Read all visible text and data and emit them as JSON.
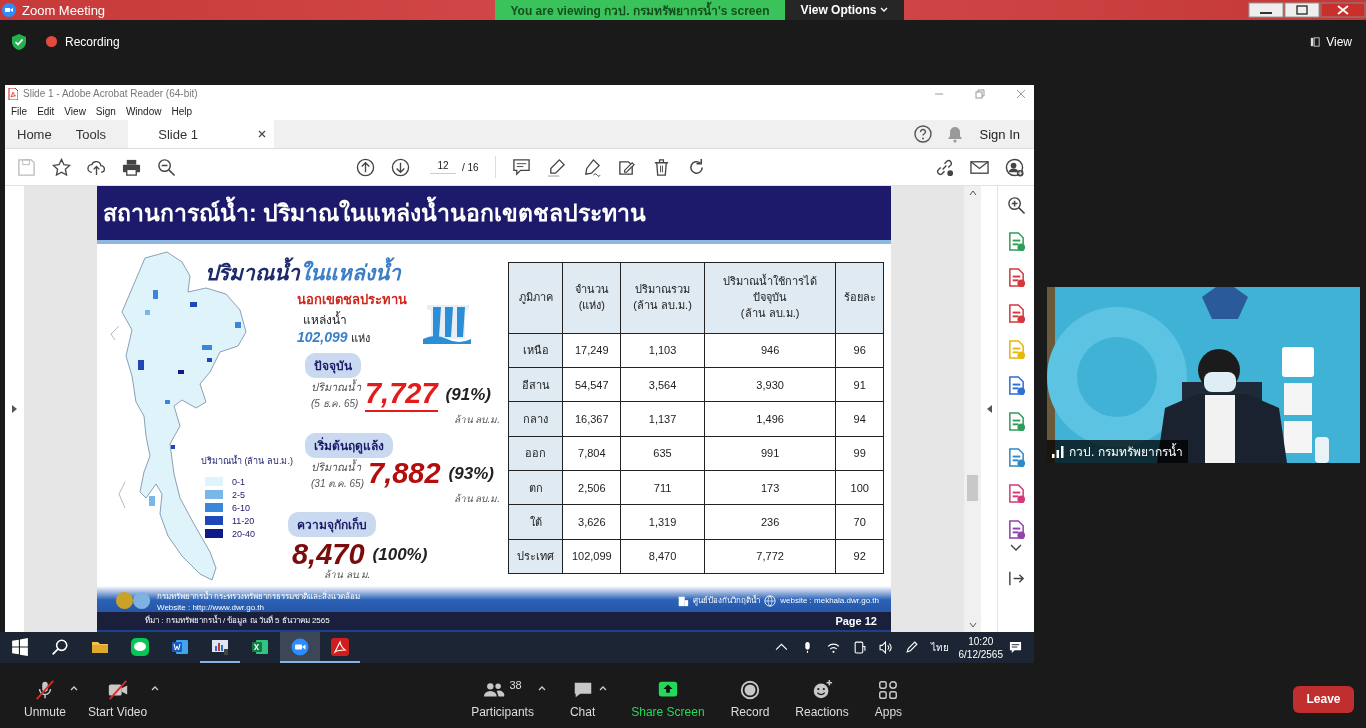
{
  "zoom_title_bar": {
    "title": "Zoom Meeting",
    "viewing_banner": "You are viewing กวป. กรมทรัพยากรน้ำ's screen",
    "view_options": "View Options"
  },
  "meeting_status": {
    "recording": "Recording",
    "view": "View"
  },
  "acrobat": {
    "title": "Slide 1 - Adobe Acrobat Reader (64-bit)",
    "menu": [
      "File",
      "Edit",
      "View",
      "Sign",
      "Window",
      "Help"
    ],
    "tabs": [
      {
        "label": "Home",
        "selected": false
      },
      {
        "label": "Tools",
        "selected": false
      },
      {
        "label": "Slide 1",
        "selected": true
      }
    ],
    "sign_in": "Sign In",
    "page_current": "12",
    "page_total": "/ 16"
  },
  "slide": {
    "title": "สถานการณ์น้ำ: ปริมาณในแหล่งน้ำนอกเขตชลประทาน",
    "heading_main": "ปริมาณน้ำ",
    "heading_accent": "ในแหล่งน้ำ",
    "subtitle": "นอกเขตชลประทาน",
    "sources_label": "แหล่งน้ำ",
    "sources_count": "102,099",
    "sources_unit": "แห่ง",
    "stats": [
      {
        "kind": "current",
        "badge": "ปัจจุบัน",
        "label": "ปริมาณน้ำ",
        "date": "(5 ธ.ค. 65)",
        "value": "7,727",
        "percent": "(91%)",
        "unit": "ล้าน ลบ.ม."
      },
      {
        "kind": "start",
        "badge": "เริ่มต้นฤดูแล้ง",
        "label": "ปริมาณน้ำ",
        "date": "(31 ต.ค. 65)",
        "value": "7,882",
        "percent": "(93%)",
        "unit": "ล้าน ลบ.ม."
      },
      {
        "kind": "capacity",
        "badge": "ความจุกักเก็บ",
        "value": "8,470",
        "percent": "(100%)",
        "unit": "ล้าน ลบ.ม."
      }
    ],
    "legend": {
      "title": "ปริมาณน้ำ (ล้าน ลบ.ม.)",
      "items": [
        {
          "label": "0-1",
          "color": "#dff3fb"
        },
        {
          "label": "2-5",
          "color": "#7ab6e8"
        },
        {
          "label": "6-10",
          "color": "#3a86db"
        },
        {
          "label": "11-20",
          "color": "#1f47b8"
        },
        {
          "label": "20-40",
          "color": "#0d1a8a"
        }
      ]
    },
    "table": {
      "columns": [
        "ภูมิภาค",
        "จำนวน\n(แห่ง)",
        "ปริมาณรวม\n(ล้าน ลบ.ม.)",
        "ปริมาณน้ำใช้การได้\nปัจจุบัน\n(ล้าน ลบ.ม.)",
        "ร้อยละ"
      ],
      "rows": [
        [
          "เหนือ",
          "17,249",
          "1,103",
          "946",
          "96"
        ],
        [
          "อีสาน",
          "54,547",
          "3,564",
          "3,930",
          "91"
        ],
        [
          "กลาง",
          "16,367",
          "1,137",
          "1,496",
          "94"
        ],
        [
          "ออก",
          "7,804",
          "635",
          "991",
          "99"
        ],
        [
          "ตก",
          "2,506",
          "711",
          "173",
          "100"
        ],
        [
          "ใต้",
          "3,626",
          "1,319",
          "236",
          "70"
        ],
        [
          "ประเทศ",
          "102,099",
          "8,470",
          "7,772",
          "92"
        ]
      ]
    },
    "footer": {
      "org": "กรมทรัพยากรน้ำ กระทรวงทรัพยากรธรรมชาติและสิ่งแวดล้อม",
      "website": "Website : http://www.dwr.go.th",
      "center": "ศูนย์ป้องกันวิกฤติน้ำ",
      "center_website": "website : mekhala.dwr.go.th",
      "source": "ที่มา : กรมทรัพยากรน้ำ / ข้อมูล ณ วันที่ 5 ธันวาคม 2565",
      "page": "Page 12"
    }
  },
  "taskbar": {
    "apps": [
      {
        "kind": "start",
        "running": false,
        "selected": false
      },
      {
        "kind": "search",
        "running": false,
        "selected": false
      },
      {
        "kind": "folder",
        "running": false,
        "selected": false
      },
      {
        "kind": "line",
        "running": false,
        "selected": false
      },
      {
        "kind": "word",
        "running": false,
        "selected": false
      },
      {
        "kind": "chart",
        "running": true,
        "selected": false
      },
      {
        "kind": "excel",
        "running": false,
        "selected": false
      },
      {
        "kind": "zoom",
        "running": true,
        "selected": true
      },
      {
        "kind": "acrobat",
        "running": true,
        "selected": false
      }
    ],
    "language": "ไทย",
    "time": "10:20",
    "date": "6/12/2565"
  },
  "video": {
    "name": "กวป. กรมทรัพยากรน้ำ"
  },
  "zoom_toolbar": {
    "buttons": [
      {
        "label": "Unmute",
        "kind": "mic",
        "off": true,
        "menu": true
      },
      {
        "label": "Start Video",
        "kind": "video",
        "off": true,
        "menu": true
      },
      {
        "label": "Participants",
        "kind": "participants",
        "count": "38",
        "menu": true
      },
      {
        "label": "Chat",
        "kind": "chat",
        "menu": true
      },
      {
        "label": "Share Screen",
        "kind": "share",
        "menu": false
      },
      {
        "label": "Record",
        "kind": "record",
        "menu": false
      },
      {
        "label": "Reactions",
        "kind": "reactions",
        "menu": false
      },
      {
        "label": "Apps",
        "kind": "apps",
        "menu": false
      }
    ],
    "leave": "Leave"
  }
}
